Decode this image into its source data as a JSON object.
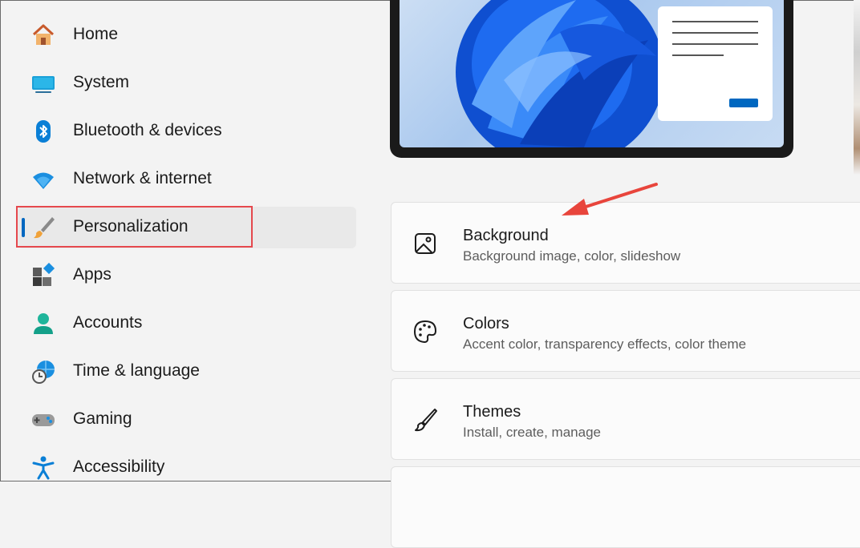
{
  "sidebar": {
    "items": [
      {
        "label": "Home",
        "icon": "home-icon"
      },
      {
        "label": "System",
        "icon": "system-icon"
      },
      {
        "label": "Bluetooth & devices",
        "icon": "bluetooth-icon"
      },
      {
        "label": "Network & internet",
        "icon": "network-icon"
      },
      {
        "label": "Personalization",
        "icon": "personalization-brush-icon",
        "selected": true
      },
      {
        "label": "Apps",
        "icon": "apps-icon"
      },
      {
        "label": "Accounts",
        "icon": "accounts-icon"
      },
      {
        "label": "Time & language",
        "icon": "time-language-icon"
      },
      {
        "label": "Gaming",
        "icon": "gaming-icon"
      },
      {
        "label": "Accessibility",
        "icon": "accessibility-icon"
      }
    ]
  },
  "cards": [
    {
      "title": "Background",
      "desc": "Background image, color, slideshow",
      "icon": "image-icon"
    },
    {
      "title": "Colors",
      "desc": "Accent color, transparency effects, color theme",
      "icon": "palette-icon"
    },
    {
      "title": "Themes",
      "desc": "Install, create, manage",
      "icon": "brush-icon"
    }
  ],
  "colors": {
    "accent": "#0067c0",
    "highlight_box": "#e5484d",
    "annotation_arrow": "#e8453c"
  }
}
